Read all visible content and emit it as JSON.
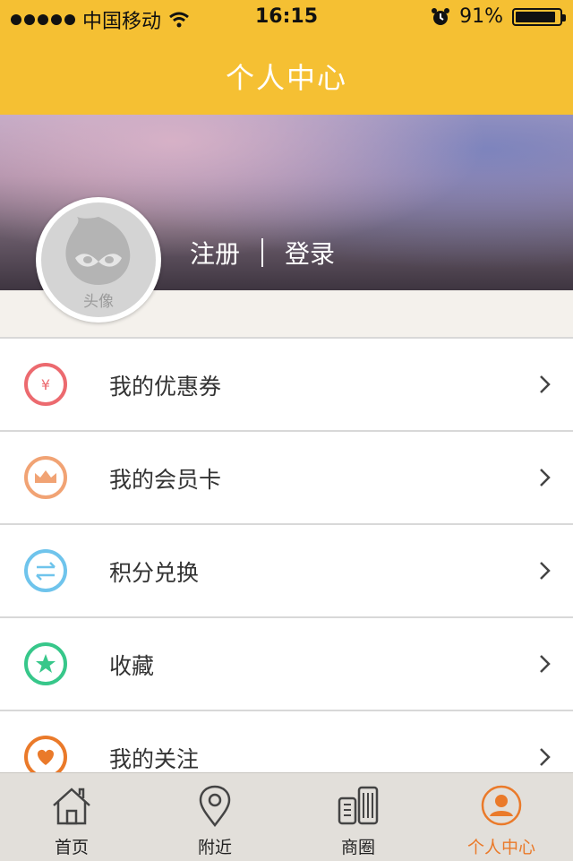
{
  "status_bar": {
    "carrier": "中国移动",
    "time": "16:15",
    "battery_text": "91%",
    "battery_level": 0.91,
    "icons": [
      "signal-dots-icon",
      "wifi-icon",
      "alarm-icon",
      "battery-icon"
    ]
  },
  "header": {
    "title": "个人中心",
    "color": "#f5c033"
  },
  "profile": {
    "avatar_label": "头像",
    "register": "注册",
    "login": "登录"
  },
  "menu": [
    {
      "label": "我的优惠券",
      "icon": "coupon-yen-icon",
      "color": "#ec6a6f",
      "glyph": "¥"
    },
    {
      "label": "我的会员卡",
      "icon": "crown-icon",
      "color": "#f1a374"
    },
    {
      "label": "积分兑换",
      "icon": "exchange-icon",
      "color": "#6fc4ec"
    },
    {
      "label": "收藏",
      "icon": "star-icon",
      "color": "#37c78a"
    },
    {
      "label": "我的关注",
      "icon": "heart-icon",
      "color": "#ea7a2a"
    }
  ],
  "tabs": [
    {
      "label": "首页",
      "icon": "home-icon",
      "active": false
    },
    {
      "label": "附近",
      "icon": "location-pin-icon",
      "active": false
    },
    {
      "label": "商圈",
      "icon": "buildings-icon",
      "active": false
    },
    {
      "label": "个人中心",
      "icon": "user-icon",
      "active": true,
      "active_color": "#ea7a2a"
    }
  ]
}
